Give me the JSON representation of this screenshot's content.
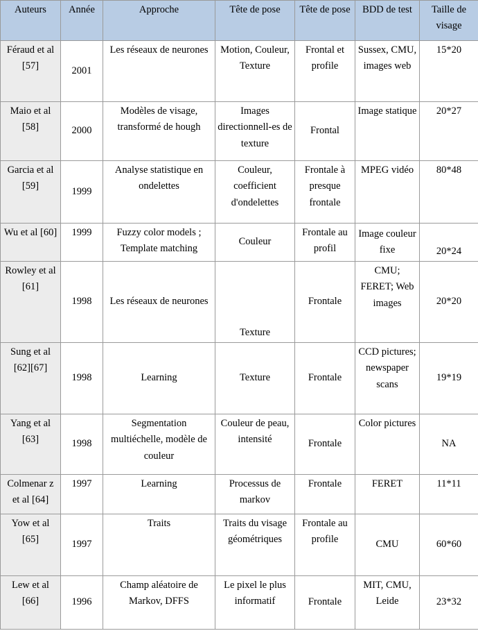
{
  "table": {
    "columns": [
      {
        "key": "auteurs",
        "label": "Auteurs"
      },
      {
        "key": "annee",
        "label": "Année"
      },
      {
        "key": "approche",
        "label": "Approche"
      },
      {
        "key": "tete1",
        "label": "Tête de pose"
      },
      {
        "key": "tete2",
        "label": "Tête de pose"
      },
      {
        "key": "bdd",
        "label": "BDD de test"
      },
      {
        "key": "taille",
        "label": "Taille de visage"
      }
    ],
    "rows": [
      {
        "auteurs": "Féraud et al [57]",
        "annee": "2001",
        "approche": "Les réseaux de neurones",
        "tete1": "Motion, Couleur, Texture",
        "tete2": "Frontal et profile",
        "bdd": "Sussex, CMU, images web",
        "taille": "15*20"
      },
      {
        "auteurs": "Maio et al [58]",
        "annee": "2000",
        "approche": "Modèles de visage, transformé de hough",
        "tete1": "Images directionnell-es de texture",
        "tete2": "Frontal",
        "bdd": "Image statique",
        "taille": "20*27"
      },
      {
        "auteurs": "Garcia et al [59]",
        "annee": "1999",
        "approche": "Analyse statistique en ondelettes",
        "tete1": "Couleur, coefficient d'ondelettes",
        "tete2": "Frontale à presque frontale",
        "bdd": "MPEG vidéo",
        "taille": "80*48"
      },
      {
        "auteurs": "Wu et al [60]",
        "annee": "1999",
        "approche": "Fuzzy color models ; Template matching",
        "tete1": "Couleur",
        "tete2": "Frontale au profil",
        "bdd": "Image couleur fixe",
        "taille": "20*24"
      },
      {
        "auteurs": "Rowley et al [61]",
        "annee": "1998",
        "approche": "Les réseaux de neurones",
        "tete1": "Texture",
        "tete2": "Frontale",
        "bdd": "CMU; FERET; Web images",
        "taille": "20*20"
      },
      {
        "auteurs": "Sung et al [62][67]",
        "annee": "1998",
        "approche": "Learning",
        "tete1": "Texture",
        "tete2": "Frontale",
        "bdd": "CCD pictures; newspaper scans",
        "taille": "19*19"
      },
      {
        "auteurs": "Yang et al [63]",
        "annee": "1998",
        "approche": "Segmentation multiéchelle, modèle de couleur",
        "tete1": "Couleur de peau, intensité",
        "tete2": "Frontale",
        "bdd": "Color pictures",
        "taille": "NA"
      },
      {
        "auteurs": "Colmenar z et al [64]",
        "annee": "1997",
        "approche": "Learning",
        "tete1": "Processus de markov",
        "tete2": "Frontale",
        "bdd": "FERET",
        "taille": "11*11"
      },
      {
        "auteurs": "Yow et al [65]",
        "annee": "1997",
        "approche": "Traits",
        "tete1": "Traits du visage géométriques",
        "tete2": "Frontale au profile",
        "bdd": "CMU",
        "taille": "60*60"
      },
      {
        "auteurs": "Lew et al [66]",
        "annee": "1996",
        "approche": "Champ aléatoire de Markov, DFFS",
        "tete1": "Le pixel le plus informatif",
        "tete2": "Frontale",
        "bdd": "MIT, CMU, Leide",
        "taille": "23*32"
      }
    ]
  },
  "style": {
    "header_fill": "#b8cce4",
    "first_column_fill": "#ececec",
    "body_fill": "#ffffff",
    "grid_color": "#9a9a9a",
    "text_color": "#000000"
  },
  "row_layout": [
    {
      "heights": 88,
      "align": [
        "top",
        "mid",
        "top",
        "top",
        "top",
        "top",
        "top"
      ]
    },
    {
      "heights": 85,
      "align": [
        "top",
        "mid",
        "top",
        "top",
        "mid",
        "top",
        "top"
      ]
    },
    {
      "heights": 90,
      "align": [
        "top",
        "mid",
        "top",
        "top",
        "top",
        "top",
        "top"
      ]
    },
    {
      "heights": 55,
      "align": [
        "top",
        "top",
        "top",
        "mid",
        "top",
        "mid",
        "bot"
      ]
    },
    {
      "heights": 117,
      "align": [
        "top",
        "mid",
        "mid",
        "bot",
        "mid",
        "top",
        "mid"
      ]
    },
    {
      "heights": 103,
      "align": [
        "top",
        "mid",
        "mid",
        "mid",
        "mid",
        "top",
        "mid"
      ]
    },
    {
      "heights": 87,
      "align": [
        "top",
        "mid",
        "top",
        "top",
        "mid",
        "top",
        "mid"
      ]
    },
    {
      "heights": 57,
      "align": [
        "top",
        "top",
        "top",
        "top",
        "top",
        "top",
        "top"
      ]
    },
    {
      "heights": 89,
      "align": [
        "top",
        "mid",
        "top",
        "top",
        "top",
        "mid",
        "mid"
      ]
    },
    {
      "heights": 77,
      "align": [
        "top",
        "mid",
        "top",
        "top",
        "mid",
        "top",
        "mid"
      ]
    }
  ]
}
